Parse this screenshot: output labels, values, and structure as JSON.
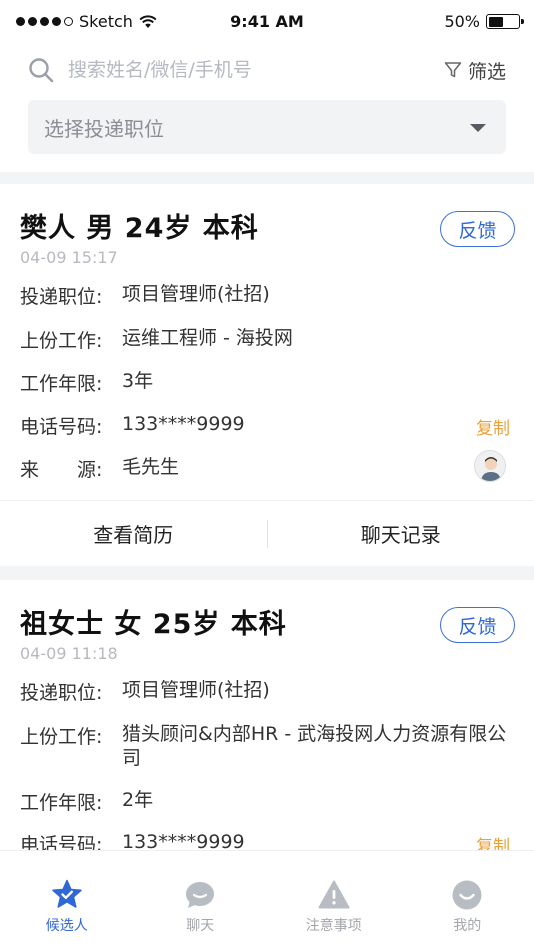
{
  "status_bar": {
    "carrier": "Sketch",
    "time": "9:41 AM",
    "battery": "50%"
  },
  "search": {
    "placeholder": "搜索姓名/微信/手机号",
    "filter_label": "筛选"
  },
  "position_select": {
    "placeholder": "选择投递职位"
  },
  "candidates": [
    {
      "name": "樊人 男 24岁 本科",
      "time": "04-09 15:17",
      "feedback_label": "反馈",
      "fields": [
        {
          "label": "投递职位:",
          "value": "项目管理师(社招)"
        },
        {
          "label": "上份工作:",
          "value": "运维工程师 - 海投网"
        },
        {
          "label": "工作年限:",
          "value": "3年"
        },
        {
          "label": "电话号码:",
          "value": "133****9999"
        },
        {
          "label": "来　　源:",
          "value": "毛先生"
        }
      ],
      "copy_label": "复制",
      "actions": {
        "resume": "查看简历",
        "chat": "聊天记录"
      }
    },
    {
      "name": "祖女士 女 25岁 本科",
      "time": "04-09 11:18",
      "feedback_label": "反馈",
      "fields": [
        {
          "label": "投递职位:",
          "value": "项目管理师(社招)"
        },
        {
          "label": "上份工作:",
          "value": "猎头顾问&内部HR - 武海投网人力资源有限公司"
        },
        {
          "label": "工作年限:",
          "value": "2年"
        },
        {
          "label": "电话号码:",
          "value": "133****9999"
        }
      ],
      "copy_label": "复制"
    }
  ],
  "tab_bar": {
    "tabs": [
      {
        "label": "候选人",
        "icon": "star-badge-icon",
        "active": true
      },
      {
        "label": "聊天",
        "icon": "chat-bubble-icon",
        "active": false
      },
      {
        "label": "注意事项",
        "icon": "warning-icon",
        "active": false
      },
      {
        "label": "我的",
        "icon": "smile-face-icon",
        "active": false
      }
    ]
  },
  "colors": {
    "accent": "#2f68d6",
    "copy": "#e8a23a",
    "muted": "#b6b9bf",
    "gap": "#f3f4f6"
  }
}
